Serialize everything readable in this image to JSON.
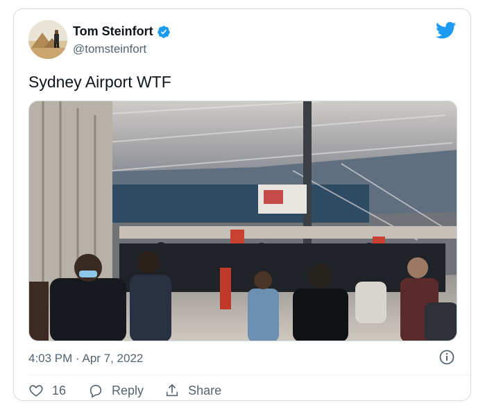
{
  "author": {
    "name": "Tom Steinfort",
    "handle": "@tomsteinfort",
    "verified": true
  },
  "tweet": {
    "text": "Sydney Airport WTF",
    "timestamp": "4:03 PM · Apr 7, 2022"
  },
  "media": {
    "kind": "image",
    "description_icon": "photo"
  },
  "actions": {
    "like_count": "16",
    "reply_label": "Reply",
    "share_label": "Share"
  },
  "icons": {
    "brand": "twitter-bird-icon",
    "verified": "verified-badge-icon",
    "info": "info-icon",
    "like": "heart-icon",
    "reply": "reply-bubble-icon",
    "share": "share-icon"
  },
  "colors": {
    "brand_blue": "#1d9bf0",
    "text_primary": "#0f1419",
    "text_secondary": "#536471",
    "border": "#cfd9de"
  }
}
